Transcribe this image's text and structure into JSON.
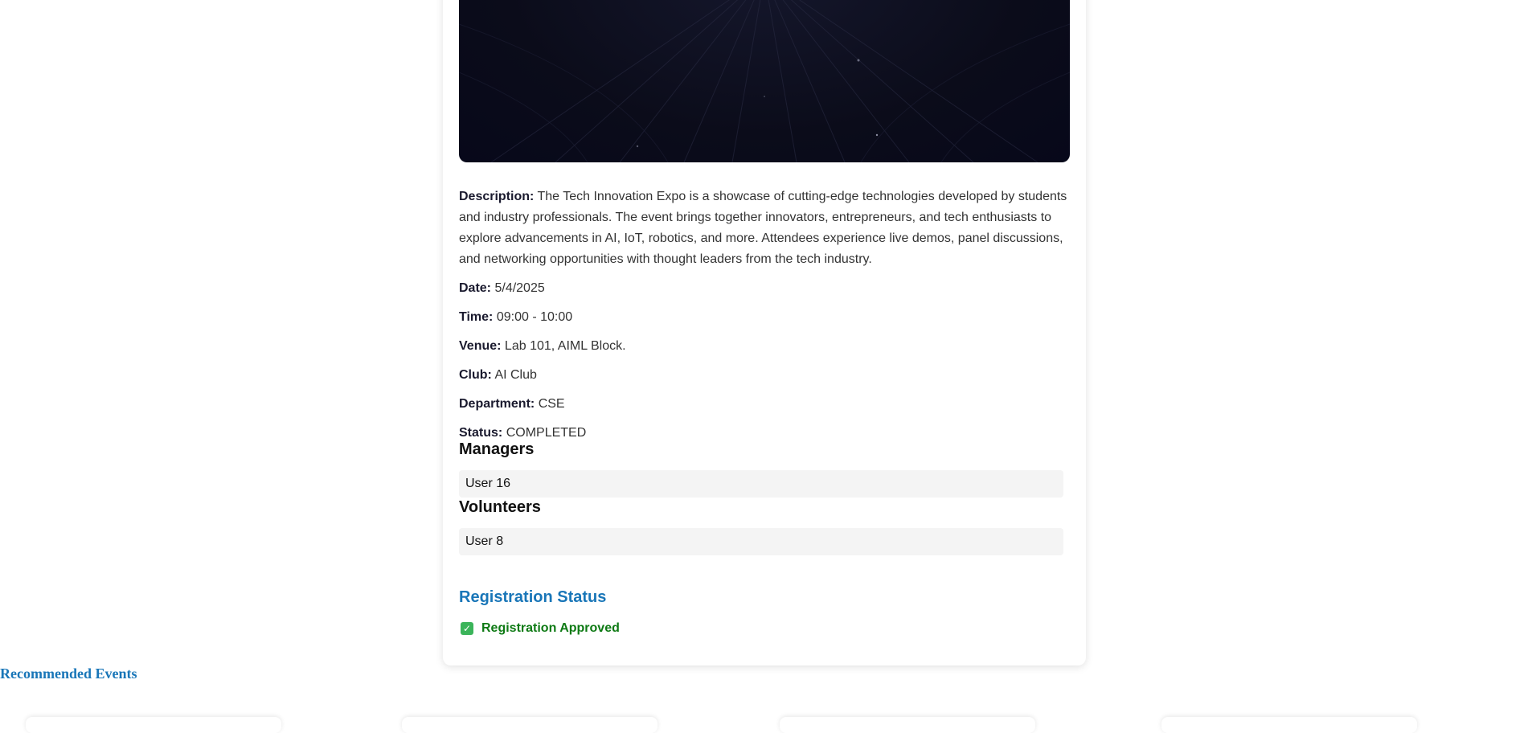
{
  "event": {
    "description_label": "Description:",
    "description": "The Tech Innovation Expo is a showcase of cutting-edge technologies developed by students and industry professionals. The event brings together innovators, entrepreneurs, and tech enthusiasts to explore advancements in AI, IoT, robotics, and more. Attendees experience live demos, panel discussions, and networking opportunities with thought leaders from the tech industry.",
    "fields": [
      {
        "label": "Date:",
        "value": "5/4/2025"
      },
      {
        "label": "Time:",
        "value": "09:00 - 10:00"
      },
      {
        "label": "Venue:",
        "value": "Lab 101, AIML Block."
      },
      {
        "label": "Club:",
        "value": "AI Club"
      },
      {
        "label": "Department:",
        "value": "CSE"
      },
      {
        "label": "Status:",
        "value": "COMPLETED"
      }
    ]
  },
  "managers": {
    "title": "Managers",
    "items": [
      "User 16"
    ]
  },
  "volunteers": {
    "title": "Volunteers",
    "items": [
      "User 8"
    ]
  },
  "registration": {
    "title": "Registration Status",
    "status": "Registration Approved",
    "status_icon": "check-box-icon",
    "status_color": "#0e7a14"
  },
  "recommended": {
    "title": "Recommended Events"
  },
  "colors": {
    "accent": "#1976b8",
    "success": "#0e7a14",
    "hero_bg": "#0b0c1a"
  }
}
